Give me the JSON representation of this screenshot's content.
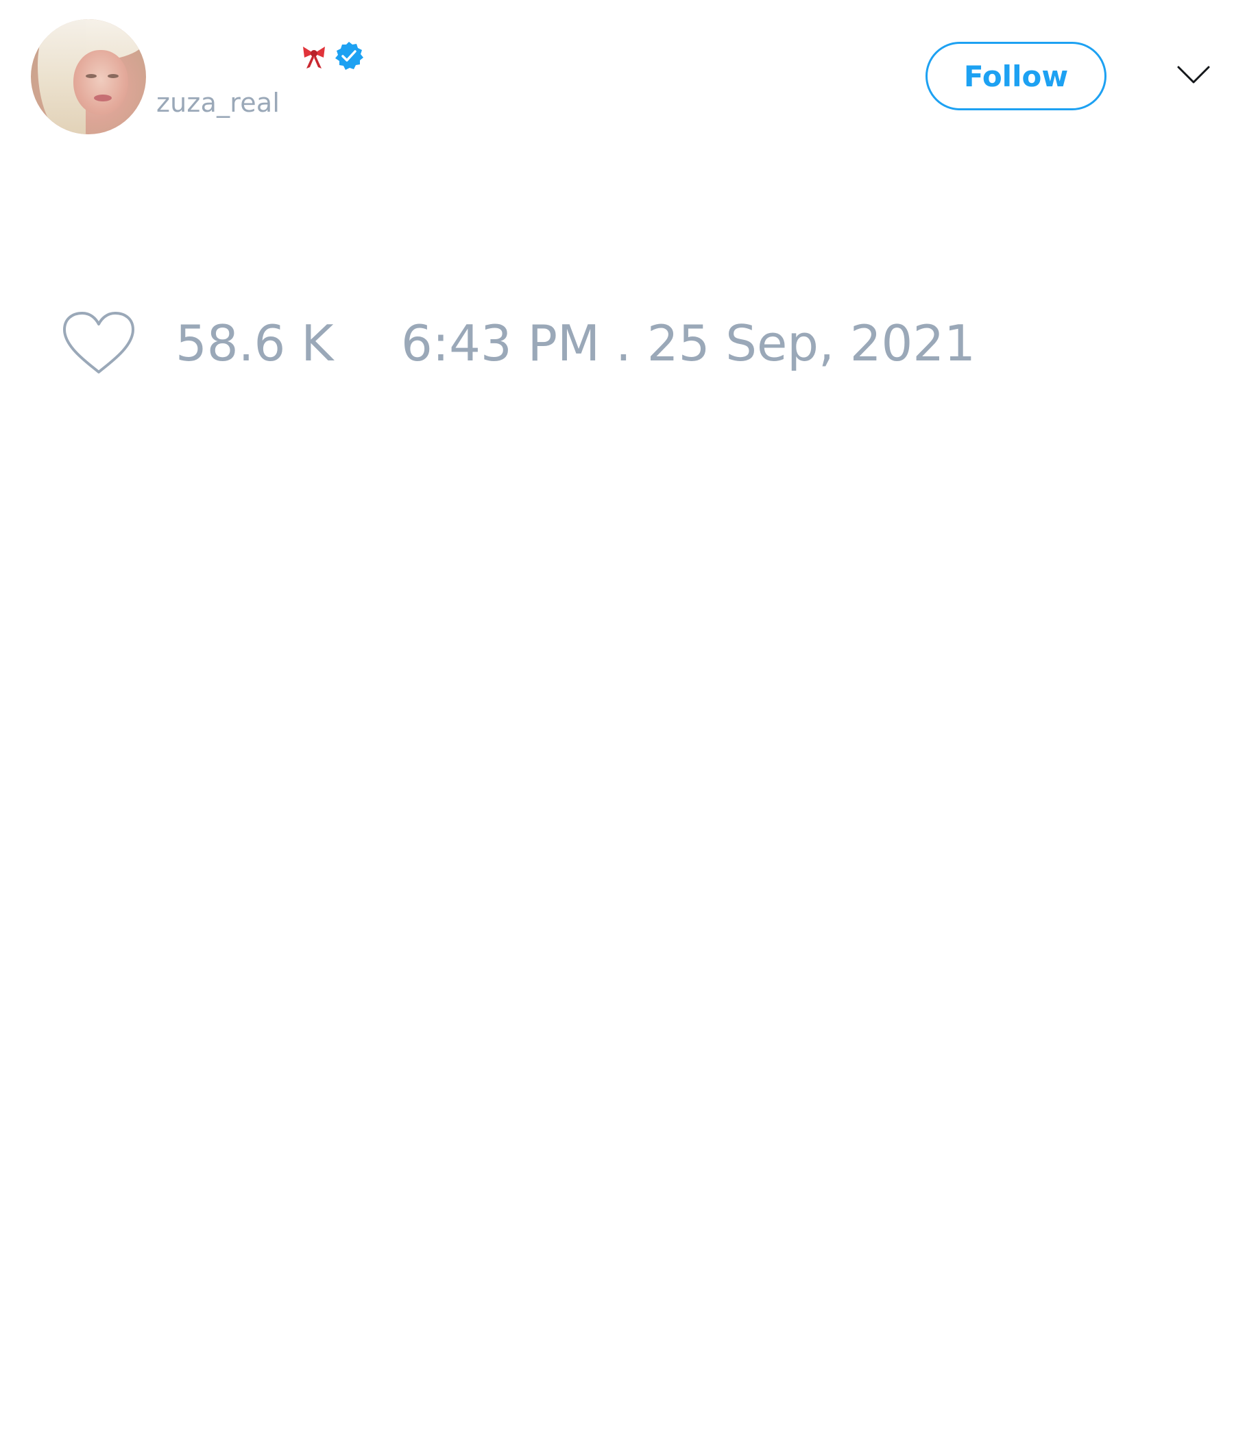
{
  "tweet": {
    "author": {
      "display_name": "",
      "handle": "zuza_real",
      "verified": true,
      "emoji_icon": "ribbon-bow-icon"
    },
    "follow_label": "Follow",
    "more_icon": "chevron-down-icon",
    "likes": {
      "icon": "heart-icon",
      "count": "58.6 K"
    },
    "timestamp": "6:43 PM . 25 Sep, 2021"
  },
  "colors": {
    "accent": "#1da1f2",
    "muted_text": "#9aa8b8",
    "bow": "#e0333a"
  }
}
